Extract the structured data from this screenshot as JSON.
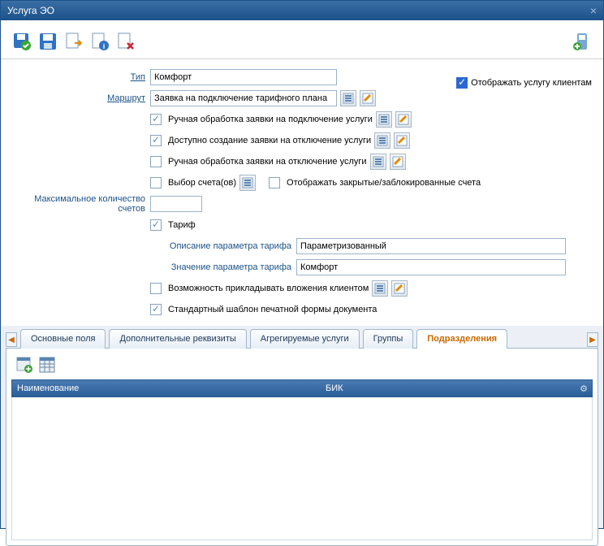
{
  "window": {
    "title": "Услуга ЭО"
  },
  "toolbar": {
    "icons": [
      "save-ok",
      "save",
      "export",
      "refresh-info",
      "doc-x",
      "plus-right"
    ]
  },
  "topright": {
    "show_clients_label": "Отображать услугу клиентам"
  },
  "form": {
    "type_label": "Тип",
    "type_value": "Комфорт",
    "route_label": "Маршрут",
    "route_value": "Заявка на подключение тарифного плана",
    "manual_connect": "Ручная обработка заявки на подключение услуги",
    "allow_disconnect": "Доступно создание заявки на отключение услуги",
    "manual_disconnect": "Ручная обработка заявки на отключение услуги",
    "select_accounts": "Выбор счета(ов)",
    "show_closed": "Отображать закрытые/заблокированные счета",
    "max_accounts_label": "Максимальное количество счетов",
    "max_accounts_value": "",
    "tariff": "Тариф",
    "tariff_desc_label": "Описание параметра тарифа",
    "tariff_desc_value": "Параметризованный",
    "tariff_val_label": "Значение параметра тарифа",
    "tariff_val_value": "Комфорт",
    "attachments": "Возможность прикладывать вложения клиентом",
    "std_template": "Стандартный шаблон печатной формы документа"
  },
  "tabs": {
    "items": [
      "Основные поля",
      "Дополнительные реквизиты",
      "Агрегируемые услуги",
      "Группы",
      "Подразделения"
    ],
    "active": 4
  },
  "grid": {
    "cols": {
      "name": "Наименование",
      "bik": "БИК"
    }
  }
}
